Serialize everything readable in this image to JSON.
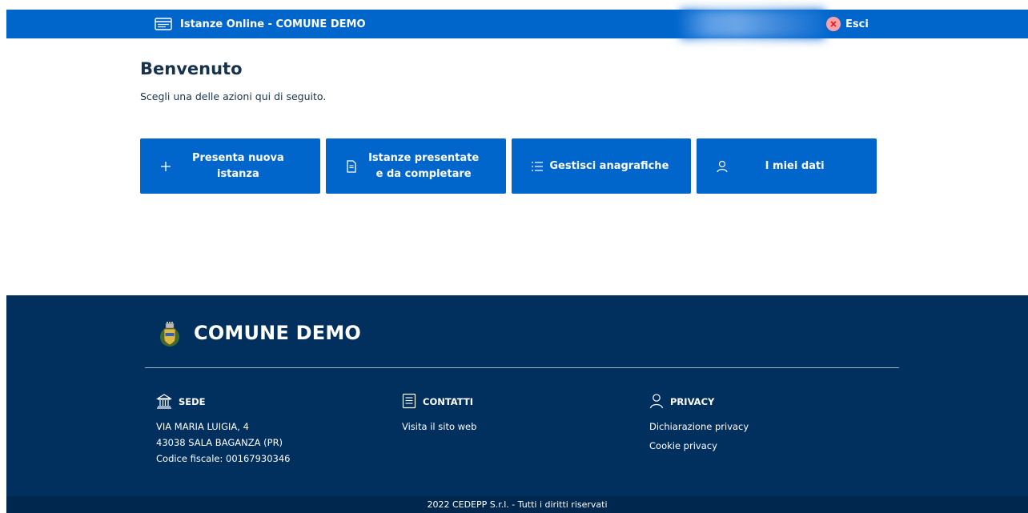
{
  "header": {
    "app_title": "Istanze Online - COMUNE DEMO",
    "logout_label": "Esci"
  },
  "main": {
    "title": "Benvenuto",
    "subtitle": "Scegli una delle azioni qui di seguito.",
    "actions": [
      {
        "label": "Presenta nuova istanza",
        "icon": "plus-icon"
      },
      {
        "label_line1": "Istanze presentate",
        "label_line2": "e da completare",
        "icon": "document-icon"
      },
      {
        "label": "Gestisci anagrafiche",
        "icon": "list-icon"
      },
      {
        "label": "I miei dati",
        "icon": "user-icon"
      }
    ]
  },
  "footer": {
    "org_name": "COMUNE DEMO",
    "sede": {
      "heading": "SEDE",
      "address_line1": "VIA MARIA LUIGIA, 4",
      "address_line2": "43038 SALA BAGANZA (PR)",
      "fiscal_code": "Codice fiscale: 00167930346"
    },
    "contatti": {
      "heading": "CONTATTI",
      "website_link": "Visita il sito web"
    },
    "privacy": {
      "heading": "PRIVACY",
      "privacy_link": "Dichiarazione privacy",
      "cookie_link": "Cookie privacy"
    },
    "copyright": "2022 CEDEPP S.r.l. - Tutti i diritti riservati"
  },
  "colors": {
    "primary": "#0066cc",
    "footer_bg": "#01305f",
    "footer_bottom": "#00284e",
    "text_dark": "#17324d"
  }
}
